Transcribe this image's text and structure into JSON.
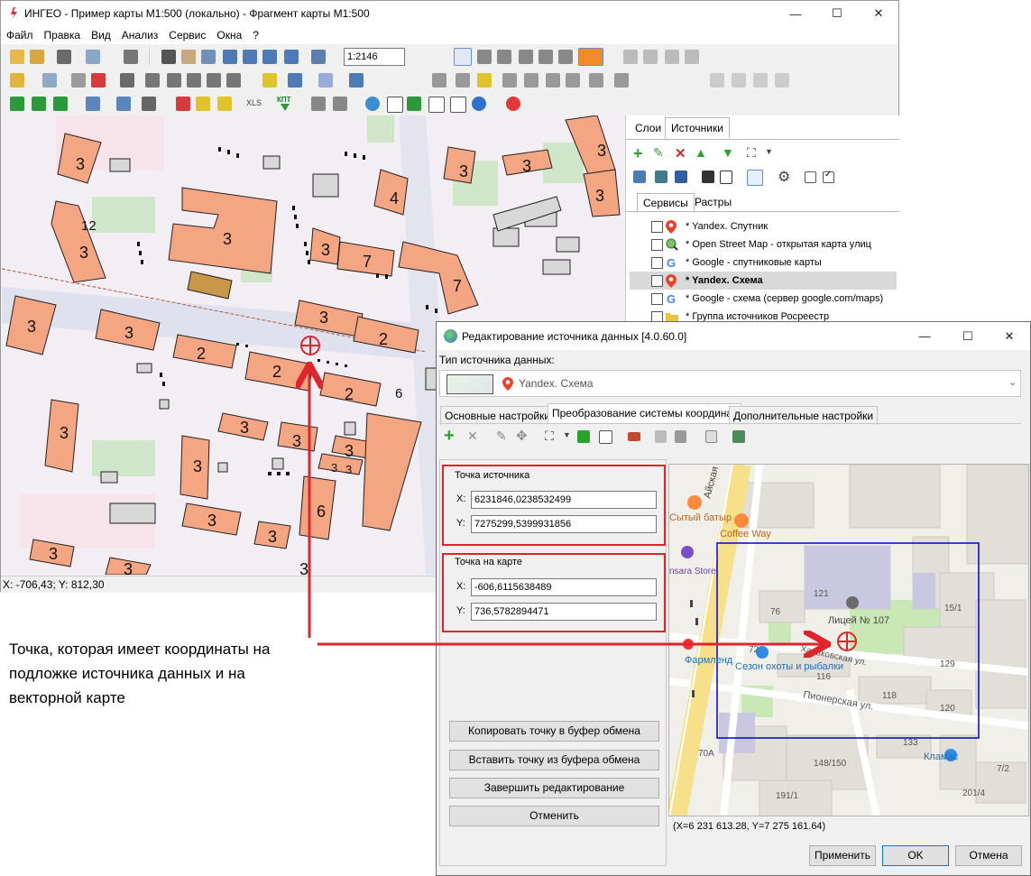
{
  "main_window": {
    "title": "ИНГЕО - Пример карты М1:500 (локально) - Фрагмент карты М1:500",
    "menu": [
      "Файл",
      "Правка",
      "Вид",
      "Анализ",
      "Сервис",
      "Окна",
      "?"
    ],
    "scale_value": "1:2146",
    "toolbar_text": {
      "xls": "XLS",
      "kpt": "КПТ"
    },
    "status": "X: -706,43; Y: 812,30",
    "map_labels": [
      "3",
      "3",
      "12",
      "3",
      "3",
      "4",
      "3",
      "3",
      "3",
      "3",
      "7",
      "7",
      "3",
      "3",
      "3",
      "2",
      "2",
      "2",
      "2",
      "6",
      "3",
      "3",
      "3",
      "3",
      "3",
      "3",
      "3",
      "3",
      "3",
      "3",
      "6",
      "3",
      "3"
    ]
  },
  "panel": {
    "tabs": [
      "Слои",
      "Источники"
    ],
    "subtabs": [
      "Сервисы",
      "Растры"
    ],
    "sources": [
      {
        "label": "* Yandex. Спутник",
        "icon": "yandex-pin-icon",
        "checked": false,
        "bold": false,
        "selected": false
      },
      {
        "label": "* Open Street Map - открытая карта улиц",
        "icon": "osm-magnifier-icon",
        "checked": false,
        "bold": false,
        "selected": false
      },
      {
        "label": "* Google - спутниковые карты",
        "icon": "google-icon",
        "checked": false,
        "bold": false,
        "selected": false
      },
      {
        "label": "* Yandex. Схема",
        "icon": "yandex-pin-icon",
        "checked": false,
        "bold": true,
        "selected": true
      },
      {
        "label": "* Google - схема (сервер google.com/maps)",
        "icon": "google-icon",
        "checked": false,
        "bold": false,
        "selected": false
      },
      {
        "label": "* Группа источников Росреестр",
        "icon": "folder-icon",
        "checked": false,
        "bold": false,
        "selected": false
      }
    ]
  },
  "dialog": {
    "title": "Редактирование источника данных [4.0.60.0]",
    "type_label": "Тип источника данных:",
    "type_value": "Yandex. Схема",
    "tabs": [
      "Основные настройки",
      "Преобразование системы координат",
      "Дополнительные настройки"
    ],
    "source_point": {
      "group_label": "Точка источника",
      "x_label": "X:",
      "x_value": "6231846,0238532499",
      "y_label": "Y:",
      "y_value": "7275299,5399931856"
    },
    "map_point": {
      "group_label": "Точка на карте",
      "x_label": "X:",
      "x_value": "-606,6115638489",
      "y_label": "Y:",
      "y_value": "736,5782894471"
    },
    "buttons": {
      "copy": "Копировать точку в буфер обмена",
      "paste": "Вставить точку из буфера обмена",
      "finish": "Завершить редактирование",
      "cancel_edit": "Отменить",
      "apply": "Применить",
      "ok": "OK",
      "cancel": "Отмена"
    },
    "map_coords": "(X=6 231 613.28, Y=7 275 161.64)",
    "map_labels": {
      "street1": "Айская",
      "poi1": "Сытый батыр",
      "poi2": "Coffee Way",
      "poi3": "nsara Store",
      "school": "Лицей № 107",
      "h121": "121",
      "h76": "76",
      "h15_1": "15/1",
      "h72": "72",
      "pharmacy": "Фармленд",
      "hunting": "Сезон охоты и рыбалки",
      "street2": "Харьковская ул.",
      "h116": "116",
      "h129": "129",
      "h118": "118",
      "street3": "Пионерская ул.",
      "h120": "120",
      "h133": "133",
      "klamas": "Кламас",
      "h70a": "70А",
      "h148": "148/150",
      "h7_2": "7/2",
      "h191": "191/1",
      "h201": "201/4"
    }
  },
  "annotation": "Точка, которая имеет координаты на подложке источника данных и на векторной карте",
  "colors": {
    "annotation_arrow": "#e0242c",
    "crosshair": "#e0242c",
    "selection_box": "#0000cc",
    "building": "#f4a582"
  }
}
